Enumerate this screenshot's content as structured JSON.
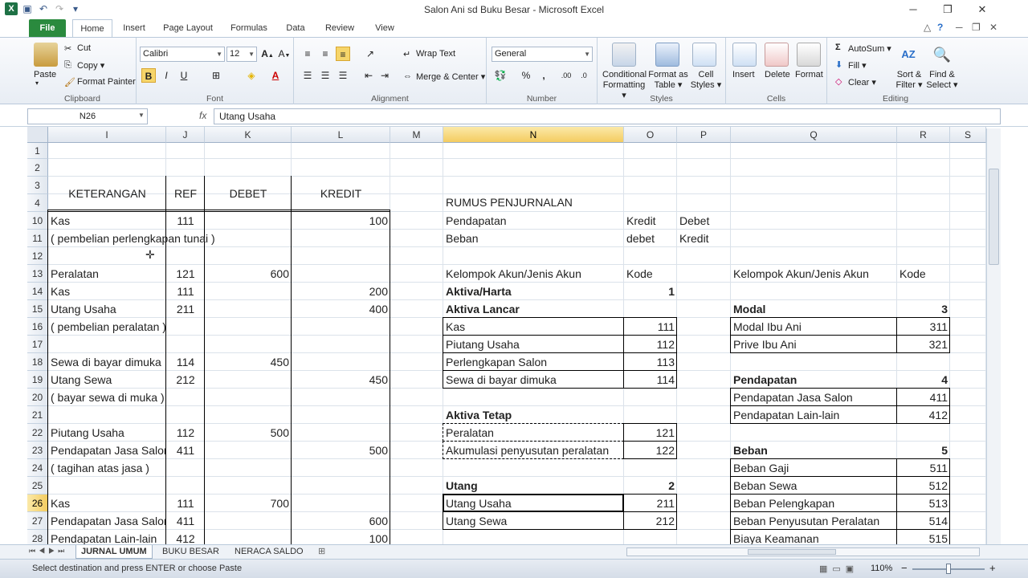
{
  "window": {
    "title": "Salon Ani sd Buku Besar - Microsoft Excel",
    "minimize": "─",
    "restore": "❐",
    "close": "✕"
  },
  "tabs": [
    "File",
    "Home",
    "Insert",
    "Page Layout",
    "Formulas",
    "Data",
    "Review",
    "View"
  ],
  "ribbon": {
    "clipboard": {
      "label": "Clipboard",
      "paste": "Paste",
      "cut": "Cut",
      "copy": "Copy ▾",
      "format_painter": "Format Painter"
    },
    "font": {
      "label": "Font",
      "name": "Calibri",
      "size": "12",
      "bold": "B",
      "italic": "I",
      "underline": "U"
    },
    "alignment": {
      "label": "Alignment",
      "wrap": "Wrap Text",
      "merge": "Merge & Center ▾"
    },
    "number": {
      "label": "Number",
      "format": "General",
      "percent": "%",
      "comma": ","
    },
    "styles": {
      "label": "Styles",
      "conditional": "Conditional Formatting ▾",
      "format_table": "Format as Table ▾",
      "cell_styles": "Cell Styles ▾"
    },
    "cells": {
      "label": "Cells",
      "insert": "Insert",
      "delete": "Delete",
      "format": "Format"
    },
    "editing": {
      "label": "Editing",
      "autosum": "AutoSum ▾",
      "fill": "Fill ▾",
      "clear": "Clear ▾",
      "sort": "Sort & Filter ▾",
      "find": "Find & Select ▾"
    }
  },
  "formula_bar": {
    "name_box": "N26",
    "fx": "fx",
    "content": "Utang Usaha"
  },
  "columns": [
    "I",
    "J",
    "K",
    "L",
    "M",
    "N",
    "O",
    "P",
    "Q",
    "R",
    "S"
  ],
  "rows": [
    "1",
    "2",
    "3",
    "4",
    "10",
    "11",
    "12",
    "13",
    "14",
    "15",
    "16",
    "17",
    "18",
    "19",
    "20",
    "21",
    "22",
    "23",
    "24",
    "25",
    "26",
    "27",
    "28"
  ],
  "journal": {
    "headers": {
      "keterangan": "KETERANGAN",
      "ref": "REF",
      "debet": "DEBET",
      "kredit": "KREDIT"
    },
    "lines": [
      {
        "row": "10",
        "text": "Kas",
        "ref": "111",
        "debet": "",
        "kredit": "100"
      },
      {
        "row": "11",
        "text": "( pembelian perlengkapan tunai )",
        "ref": "",
        "debet": "",
        "kredit": ""
      },
      {
        "row": "12",
        "text": "",
        "ref": "",
        "debet": "",
        "kredit": ""
      },
      {
        "row": "13",
        "text": "Peralatan",
        "ref": "121",
        "debet": "600",
        "kredit": ""
      },
      {
        "row": "14",
        "text": "Kas",
        "ref": "111",
        "debet": "",
        "kredit": "200"
      },
      {
        "row": "15",
        "text": "Utang Usaha",
        "ref": "211",
        "debet": "",
        "kredit": "400"
      },
      {
        "row": "16",
        "text": "( pembelian peralatan )",
        "ref": "",
        "debet": "",
        "kredit": ""
      },
      {
        "row": "17",
        "text": "",
        "ref": "",
        "debet": "",
        "kredit": ""
      },
      {
        "row": "18",
        "text": "Sewa di bayar dimuka",
        "ref": "114",
        "debet": "450",
        "kredit": ""
      },
      {
        "row": "19",
        "text": "Utang Sewa",
        "ref": "212",
        "debet": "",
        "kredit": "450"
      },
      {
        "row": "20",
        "text": "( bayar sewa di muka )",
        "ref": "",
        "debet": "",
        "kredit": ""
      },
      {
        "row": "21",
        "text": "",
        "ref": "",
        "debet": "",
        "kredit": ""
      },
      {
        "row": "22",
        "text": "Piutang Usaha",
        "ref": "112",
        "debet": "500",
        "kredit": ""
      },
      {
        "row": "23",
        "text": "Pendapatan Jasa Salon",
        "ref": "411",
        "debet": "",
        "kredit": "500"
      },
      {
        "row": "24",
        "text": "( tagihan atas jasa )",
        "ref": "",
        "debet": "",
        "kredit": ""
      },
      {
        "row": "25",
        "text": "",
        "ref": "",
        "debet": "",
        "kredit": ""
      },
      {
        "row": "26",
        "text": "Kas",
        "ref": "111",
        "debet": "700",
        "kredit": ""
      },
      {
        "row": "27",
        "text": "Pendapatan Jasa Salon",
        "ref": "411",
        "debet": "",
        "kredit": "600"
      },
      {
        "row": "28",
        "text": "Pendapatan Lain-lain",
        "ref": "412",
        "debet": "",
        "kredit": "100"
      }
    ]
  },
  "rumus": {
    "title": "RUMUS PENJURNALAN",
    "pendapatan": {
      "label": "Pendapatan",
      "o": "Kredit",
      "p": "Debet"
    },
    "beban": {
      "label": "Beban",
      "o": "debet",
      "p": "Kredit"
    }
  },
  "akun_left": {
    "header": {
      "label": "Kelompok Akun/Jenis Akun",
      "kode": "Kode"
    },
    "aktiva": {
      "label": "Aktiva/Harta",
      "kode": "1"
    },
    "lancar": {
      "label": "Aktiva Lancar"
    },
    "lancar_items": [
      {
        "label": "Kas",
        "kode": "111"
      },
      {
        "label": "Piutang Usaha",
        "kode": "112"
      },
      {
        "label": "Perlengkapan Salon",
        "kode": "113"
      },
      {
        "label": "Sewa di bayar dimuka",
        "kode": "114"
      }
    ],
    "tetap": {
      "label": "Aktiva Tetap"
    },
    "tetap_items": [
      {
        "label": "Peralatan",
        "kode": "121"
      },
      {
        "label": "Akumulasi penyusutan peralatan",
        "kode": "122"
      }
    ],
    "utang": {
      "label": "Utang",
      "kode": "2"
    },
    "utang_items": [
      {
        "label": "Utang Usaha",
        "kode": "211"
      },
      {
        "label": "Utang Sewa",
        "kode": "212"
      }
    ]
  },
  "akun_right": {
    "header": {
      "label": "Kelompok Akun/Jenis Akun",
      "kode": "Kode"
    },
    "modal": {
      "label": "Modal",
      "kode": "3"
    },
    "modal_items": [
      {
        "label": "Modal Ibu Ani",
        "kode": "311"
      },
      {
        "label": "Prive Ibu Ani",
        "kode": "321"
      }
    ],
    "pendapatan": {
      "label": "Pendapatan",
      "kode": "4"
    },
    "pendapatan_items": [
      {
        "label": "Pendapatan Jasa Salon",
        "kode": "411"
      },
      {
        "label": "Pendapatan Lain-lain",
        "kode": "412"
      }
    ],
    "beban": {
      "label": "Beban",
      "kode": "5"
    },
    "beban_items": [
      {
        "label": "Beban Gaji",
        "kode": "511"
      },
      {
        "label": "Beban Sewa",
        "kode": "512"
      },
      {
        "label": "Beban Pelengkapan",
        "kode": "513"
      },
      {
        "label": "Beban Penyusutan Peralatan",
        "kode": "514"
      },
      {
        "label": "Biaya Keamanan",
        "kode": "515"
      }
    ]
  },
  "sheets": [
    "JURNAL UMUM",
    "BUKU BESAR",
    "NERACA SALDO"
  ],
  "status": {
    "message": "Select destination and press ENTER or choose Paste",
    "zoom": "110%",
    "zoom_out": "−",
    "zoom_in": "+"
  }
}
